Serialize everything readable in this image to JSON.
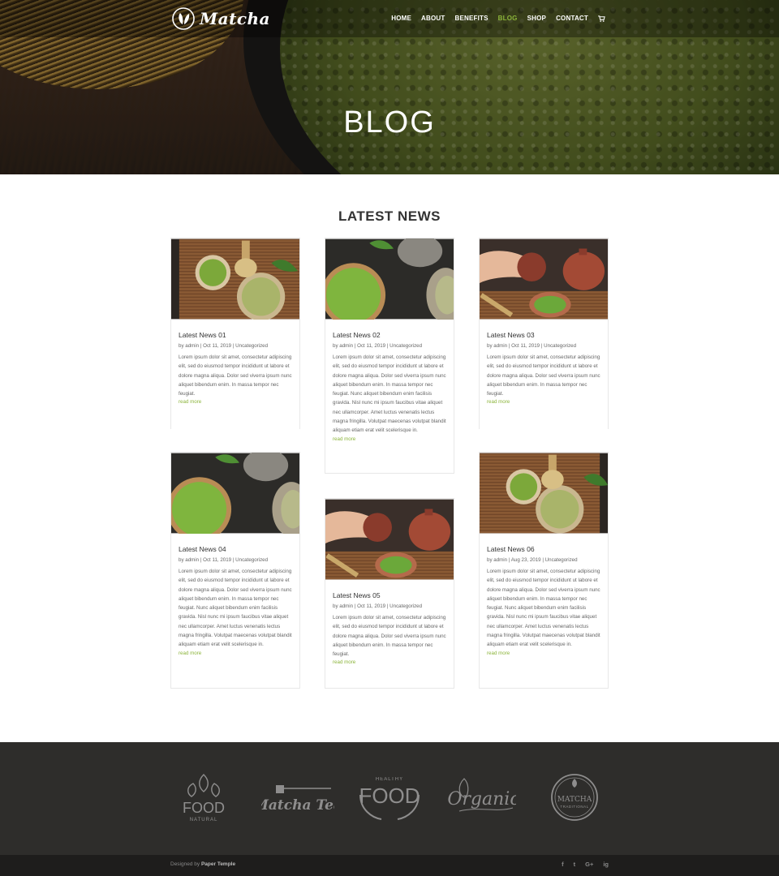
{
  "header": {
    "logo_text": "Matcha",
    "nav": [
      {
        "label": "HOME"
      },
      {
        "label": "ABOUT"
      },
      {
        "label": "BENEFITS"
      },
      {
        "label": "BLOG",
        "active": true
      },
      {
        "label": "SHOP"
      },
      {
        "label": "CONTACT"
      }
    ]
  },
  "hero": {
    "title": "BLOG"
  },
  "section": {
    "title": "LATEST NEWS"
  },
  "posts": [
    {
      "title": "Latest News 01",
      "meta": "by admin | Oct 11, 2019 | Uncategorized",
      "excerpt": "Lorem ipsum dolor sit amet, consectetur adipiscing elit, sed do eiusmod tempor incididunt ut labore et dolore magna aliqua. Dolor sed viverra ipsum nunc aliquet bibendum enim. In massa tempor nec feugiat.",
      "more": "read more",
      "image": "bamboo-mat-whisk"
    },
    {
      "title": "Latest News 02",
      "meta": "by admin | Oct 11, 2019 | Uncategorized",
      "excerpt": "Lorem ipsum dolor sit amet, consectetur adipiscing elit, sed do eiusmod tempor incididunt ut labore et dolore magna aliqua. Dolor sed viverra ipsum nunc aliquet bibendum enim. In massa tempor nec feugiat. Nunc aliquet bibendum enim facilisis gravida. Nisl nunc mi ipsum faucibus vitae aliquet nec ullamcorper. Amet luctus venenatis lectus magna fringilla. Volutpat maecenas volutpat blandit aliquam etiam erat velit scelerisque in.",
      "more": "read more",
      "image": "powder-bowl-dark"
    },
    {
      "title": "Latest News 03",
      "meta": "by admin | Oct 11, 2019 | Uncategorized",
      "excerpt": "Lorem ipsum dolor sit amet, consectetur adipiscing elit, sed do eiusmod tempor incididunt ut labore et dolore magna aliqua. Dolor sed viverra ipsum nunc aliquet bibendum enim. In massa tempor nec feugiat.",
      "more": "read more",
      "image": "teapot-hands"
    },
    {
      "title": "Latest News 04",
      "meta": "by admin | Oct 11, 2019 | Uncategorized",
      "excerpt": "Lorem ipsum dolor sit amet, consectetur adipiscing elit, sed do eiusmod tempor incididunt ut labore et dolore magna aliqua. Dolor sed viverra ipsum nunc aliquet bibendum enim. In massa tempor nec feugiat. Nunc aliquet bibendum enim facilisis gravida. Nisl nunc mi ipsum faucibus vitae aliquet nec ullamcorper. Amet luctus venenatis lectus magna fringilla. Volutpat maecenas volutpat blandit aliquam etiam erat velit scelerisque in.",
      "more": "read more",
      "image": "powder-bowl-dark"
    },
    {
      "title": "Latest News 05",
      "meta": "by admin | Oct 11, 2019 | Uncategorized",
      "excerpt": "Lorem ipsum dolor sit amet, consectetur adipiscing elit, sed do eiusmod tempor incididunt ut labore et dolore magna aliqua. Dolor sed viverra ipsum nunc aliquet bibendum enim. In massa tempor nec feugiat.",
      "more": "read more",
      "image": "teapot-hands"
    },
    {
      "title": "Latest News 06",
      "meta": "by admin | Aug 23, 2019 | Uncategorized",
      "excerpt": "Lorem ipsum dolor sit amet, consectetur adipiscing elit, sed do eiusmod tempor incididunt ut labore et dolore magna aliqua. Dolor sed viverra ipsum nunc aliquet bibendum enim. In massa tempor nec feugiat. Nunc aliquet bibendum enim facilisis gravida. Nisl nunc mi ipsum faucibus vitae aliquet nec ullamcorper. Amet luctus venenatis lectus magna fringilla. Volutpat maecenas volutpat blandit aliquam etiam erat velit scelerisque in.",
      "more": "read more",
      "image": "bamboo-mat-whisk"
    }
  ],
  "brands": [
    "FOOD NATURAL",
    "Matcha Tea",
    "HEALTHY FOOD",
    "Organic",
    "MATCHA TRADITIONAL"
  ],
  "footer": {
    "designed_by": "Designed by",
    "designer": "Paper Temple",
    "social": [
      "f",
      "t",
      "G+",
      "ig"
    ]
  },
  "colors": {
    "accent": "#8bb43a",
    "footer_bg": "#2e2d2b",
    "bottom_bar_bg": "#1e1d1c"
  }
}
